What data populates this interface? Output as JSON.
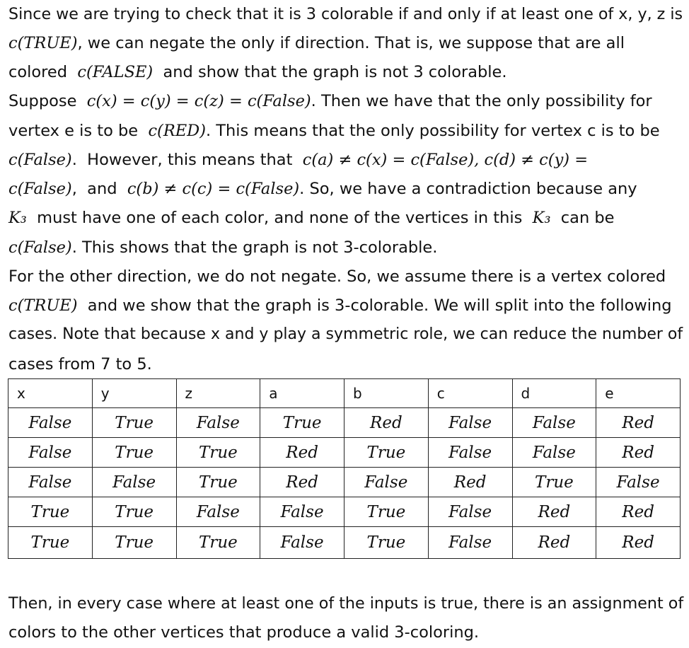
{
  "paragraph1": {
    "line1": [
      "Since we are trying to check that it is 3 colorable if and only if at least one of x, y, z is"
    ],
    "line2": [
      "c(TRUE)",
      ", we can negate the only if direction. That is, we suppose that are all"
    ],
    "line3": [
      "colored  ",
      "c(FALSE)",
      "  and show that the graph is not 3 colorable."
    ]
  },
  "paragraph2": {
    "line1": [
      "Suppose  ",
      "c(x) = c(y) = c(z) = c(False)",
      ". Then we have that the only possibility for"
    ],
    "line2": [
      "vertex e is to be  ",
      "c(RED)",
      ". This means that the only possibility for vertex c is to be"
    ],
    "line3": [
      "c(False)",
      ".  However, this means that  ",
      "c(a) ≠ c(x) = c(False), c(d) ≠ c(y) ="
    ],
    "line4": [
      "c(False)",
      ",  and  ",
      "c(b) ≠ c(c) = c(False)",
      ". So, we have a contradiction because any"
    ],
    "line5": [
      "K₃",
      "  must have one of each color, and none of the vertices in this  ",
      "K₃",
      "  can be"
    ],
    "line6": [
      "c(False)",
      ". This shows that the graph is not 3-colorable."
    ]
  },
  "paragraph3": {
    "line1": [
      "For the other direction, we do not negate. So, we assume there is a vertex colored"
    ],
    "line2": [
      "c(TRUE)",
      "  and we show that the graph is 3-colorable. We will split into the following"
    ],
    "line3": [
      "cases. Note that because x and y play a symmetric role, we can reduce the number of"
    ],
    "line4": [
      "cases from 7 to 5."
    ]
  },
  "table": {
    "headers": [
      "x",
      "y",
      "z",
      "a",
      "b",
      "c",
      "d",
      "e"
    ],
    "rows": [
      [
        "False",
        "True",
        "False",
        "True",
        "Red",
        "False",
        "False",
        "Red"
      ],
      [
        "False",
        "True",
        "True",
        "Red",
        "True",
        "False",
        "False",
        "Red"
      ],
      [
        "False",
        "False",
        "True",
        "Red",
        "False",
        "Red",
        "True",
        "False"
      ],
      [
        "True",
        "True",
        "False",
        "False",
        "True",
        "False",
        "Red",
        "Red"
      ],
      [
        "True",
        "True",
        "True",
        "False",
        "True",
        "False",
        "Red",
        "Red"
      ]
    ]
  },
  "paragraph4": {
    "line1": [
      "Then, in every case where at least one of the inputs is true, there is an assignment of"
    ],
    "line2": [
      "colors to the other vertices that produce a valid 3-coloring."
    ]
  }
}
